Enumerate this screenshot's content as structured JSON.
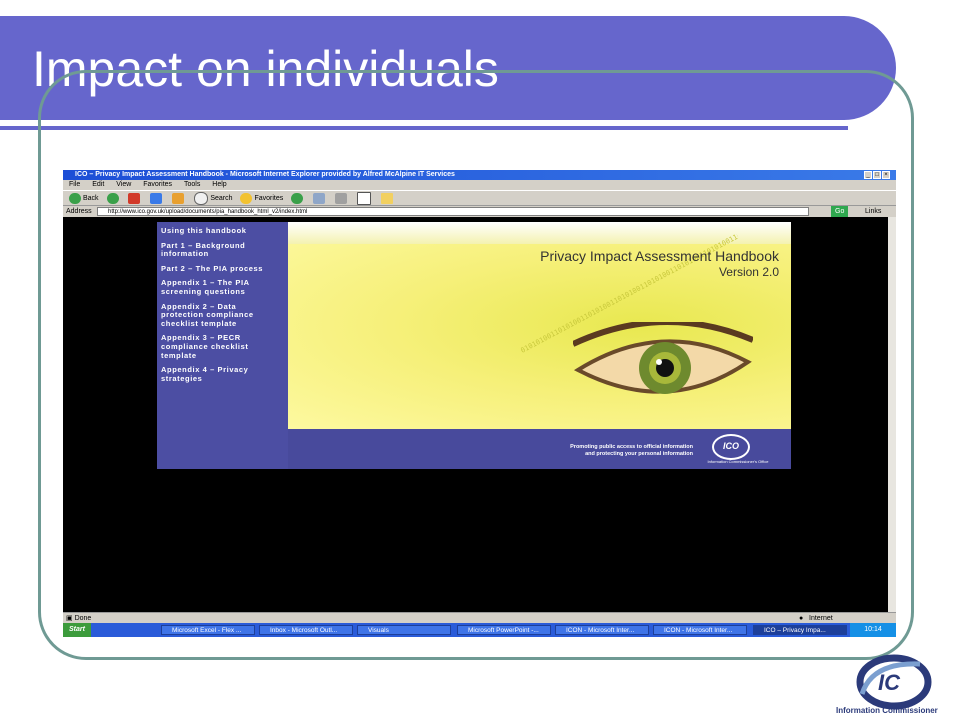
{
  "slide": {
    "title": "Impact on individuals"
  },
  "window": {
    "title": "ICO – Privacy Impact Assessment Handbook - Microsoft Internet Explorer provided by Alfred McAlpine IT Services",
    "menu": [
      "File",
      "Edit",
      "View",
      "Favorites",
      "Tools",
      "Help"
    ],
    "toolbar": {
      "back": "Back",
      "search": "Search",
      "favorites": "Favorites"
    },
    "address_label": "Address",
    "address_url": "http://www.ico.gov.uk/upload/documents/pia_handbook_html_v2/index.html",
    "go": "Go",
    "links": "Links"
  },
  "page": {
    "sidebar": [
      "Using this handbook",
      "Part 1 – Background information",
      "Part 2 – The PIA process",
      "Appendix 1 – The PIA screening questions",
      "Appendix 2 – Data protection compliance checklist template",
      "Appendix 3 – PECR compliance checklist template",
      "Appendix 4 – Privacy strategies"
    ],
    "hero_title": "Privacy Impact Assessment Handbook",
    "hero_version": "Version 2.0",
    "promo_line1": "Promoting public access to official information",
    "promo_line2": "and protecting your personal information",
    "ico_logo": "ICO",
    "ico_sub": "Information Commissioner's Office"
  },
  "status": {
    "left": "Done",
    "zone": "Internet"
  },
  "taskbar": {
    "start": "Start",
    "tasks": [
      "Microsoft Excel - Flex ...",
      "Inbox - Microsoft Outl...",
      "Visuals",
      "Microsoft PowerPoint -...",
      "ICON - Microsoft Inter...",
      "ICON - Microsoft Inter...",
      "ICO – Privacy Impa..."
    ],
    "clock": "10:14"
  },
  "footer_logo": {
    "text": "Information Commissioner"
  }
}
